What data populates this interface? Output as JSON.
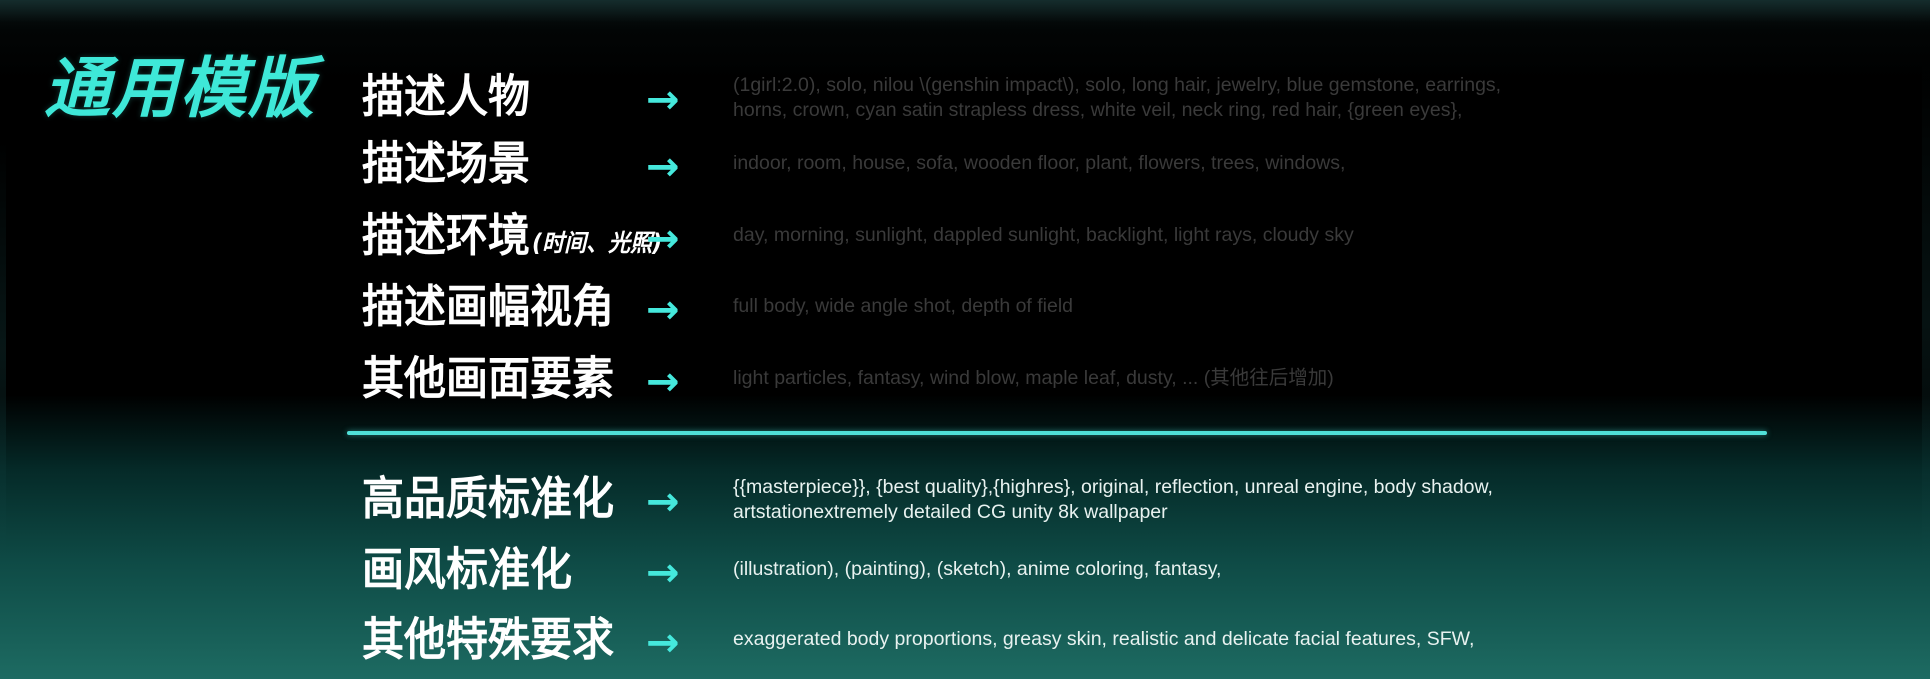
{
  "title": "通用模版",
  "upper_rows": [
    {
      "label": "描述人物",
      "note": "",
      "description": "(1girl:2.0), solo, nilou \\(genshin impact\\), solo, long hair, jewelry, blue gemstone, earrings,\nhorns, crown, cyan satin strapless dress, white veil, neck ring, red hair, {green eyes},"
    },
    {
      "label": "描述场景",
      "note": "",
      "description": "indoor, room, house, sofa, wooden floor, plant, flowers, trees, windows,"
    },
    {
      "label": "描述环境",
      "note": "(时间、光照)",
      "description": "day, morning, sunlight, dappled sunlight, backlight, light rays, cloudy sky"
    },
    {
      "label": "描述画幅视角",
      "note": "",
      "description": "full body, wide angle shot, depth of field"
    },
    {
      "label": "其他画面要素",
      "note": "",
      "description": "light particles, fantasy, wind blow, maple leaf, dusty, ... (其他往后增加)"
    }
  ],
  "lower_rows": [
    {
      "label": "高品质标准化",
      "description": "{{masterpiece}}, {best quality},{highres}, original, reflection, unreal engine, body shadow,\nartstationextremely detailed CG unity 8k wallpaper"
    },
    {
      "label": "画风标准化",
      "description": "(illustration), (painting), (sketch), anime coloring, fantasy,"
    },
    {
      "label": "其他特殊要求",
      "description": "exaggerated body proportions, greasy skin, realistic and delicate facial features, SFW,"
    }
  ],
  "arrow_glyph": "→",
  "colors": {
    "accent": "#3ee8d8",
    "arrow": "#45e8dc",
    "divider": "#50e0d8",
    "upper_desc_text": "#3a3a3a",
    "lower_desc_text": "#e8f2f0",
    "label_text": "#ffffff"
  }
}
